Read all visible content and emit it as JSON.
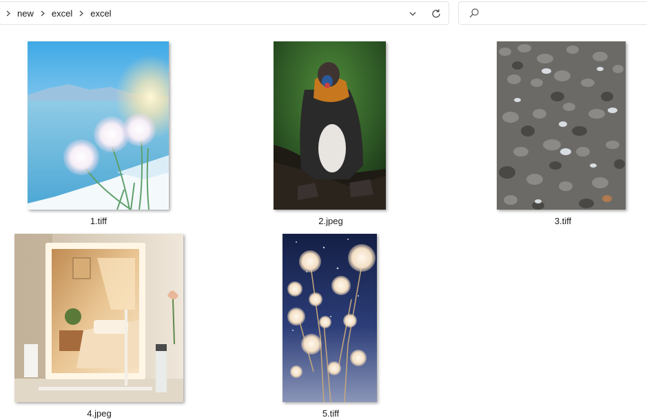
{
  "breadcrumb": [
    "new",
    "excel",
    "excel"
  ],
  "search": {
    "placeholder": ""
  },
  "files": [
    {
      "name": "1.tiff",
      "type": "tiff",
      "subject": "snowy lake with white cotton grass flowers"
    },
    {
      "name": "2.jpeg",
      "type": "jpeg",
      "subject": "mandrill monkey sitting on branch"
    },
    {
      "name": "3.tiff",
      "type": "tiff",
      "subject": "grey pebbles and stones"
    },
    {
      "name": "4.jpeg",
      "type": "jpeg",
      "subject": "lighted vanity mirror with bedroom reflection"
    },
    {
      "name": "5.tiff",
      "type": "tiff",
      "subject": "pale flowers on starry night background"
    }
  ],
  "icons": {
    "breadcrumb_separator": "chevron-right-icon",
    "address_dropdown": "chevron-down-icon",
    "refresh": "refresh-icon",
    "search": "search-icon"
  }
}
